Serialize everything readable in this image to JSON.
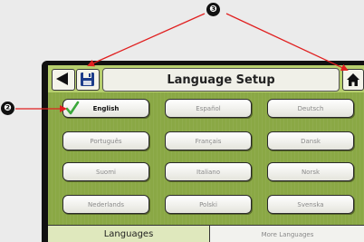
{
  "header": {
    "title": "Language Setup",
    "back_icon": "back-arrow-icon",
    "save_icon": "save-disk-icon",
    "home_icon": "home-icon"
  },
  "languages": [
    {
      "label": "English",
      "selected": true
    },
    {
      "label": "Español",
      "selected": false
    },
    {
      "label": "Deutsch",
      "selected": false
    },
    {
      "label": "Português",
      "selected": false
    },
    {
      "label": "Français",
      "selected": false
    },
    {
      "label": "Dansk",
      "selected": false
    },
    {
      "label": "Suomi",
      "selected": false
    },
    {
      "label": "Italiano",
      "selected": false
    },
    {
      "label": "Norsk",
      "selected": false
    },
    {
      "label": "Nederlands",
      "selected": false
    },
    {
      "label": "Polski",
      "selected": false
    },
    {
      "label": "Svenska",
      "selected": false
    }
  ],
  "tabs": [
    {
      "label": "Languages",
      "active": true
    },
    {
      "label": "More Languages",
      "active": false
    }
  ],
  "callouts": {
    "selected_marker": "❷",
    "nav_marker": "❸",
    "color": "#e02020"
  },
  "colors": {
    "screen_green": "#8aa845",
    "titlebar_green": "#b7cf6e",
    "check_green": "#3aa83a"
  }
}
